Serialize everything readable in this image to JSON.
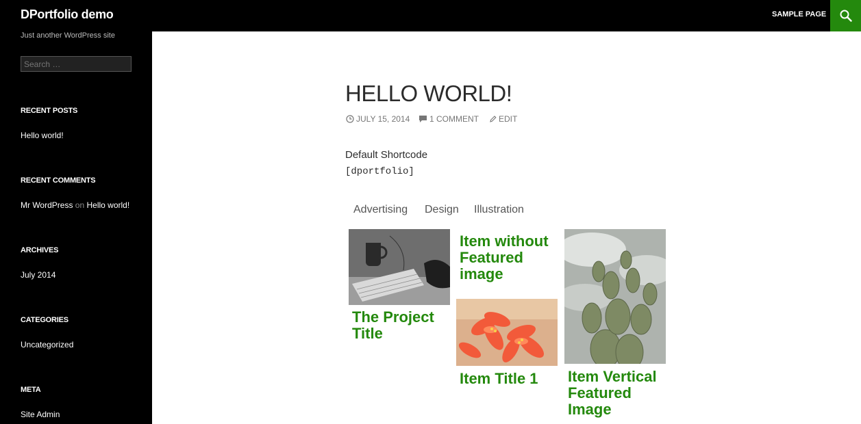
{
  "header": {
    "site_title": "DPortfolio demo",
    "nav_sample": "SAMPLE PAGE",
    "accent": "#24890d",
    "search_icon": "search-icon"
  },
  "sidebar": {
    "tagline": "Just another WordPress site",
    "search_placeholder": "Search …",
    "recent_posts": {
      "title": "RECENT POSTS",
      "items": [
        "Hello world!"
      ]
    },
    "recent_comments": {
      "title": "RECENT COMMENTS",
      "author": "Mr WordPress",
      "on": "on",
      "post": "Hello world!"
    },
    "archives": {
      "title": "ARCHIVES",
      "items": [
        "July 2014"
      ]
    },
    "categories": {
      "title": "CATEGORIES",
      "items": [
        "Uncategorized"
      ]
    },
    "meta": {
      "title": "META",
      "items": [
        "Site Admin"
      ]
    }
  },
  "post": {
    "title": "HELLO WORLD!",
    "date": "JULY 15, 2014",
    "comments": "1 COMMENT",
    "edit": "EDIT",
    "paragraph": "Default Shortcode",
    "code": "[dportfolio]"
  },
  "portfolio": {
    "filters": [
      "Advertising",
      "Design",
      "Illustration"
    ],
    "items": [
      {
        "title_lines": [
          "The Project",
          "Title"
        ],
        "image": "keyboard-mouse-photo"
      },
      {
        "title_lines": [
          "Item without",
          "Featured",
          "image"
        ],
        "image": null
      },
      {
        "title_lines": [
          "Item Title 1"
        ],
        "image": "orange-flowers-photo"
      },
      {
        "title_lines": [
          "Item Vertical",
          "Featured",
          "Image"
        ],
        "image": "cactus-photo"
      }
    ]
  }
}
